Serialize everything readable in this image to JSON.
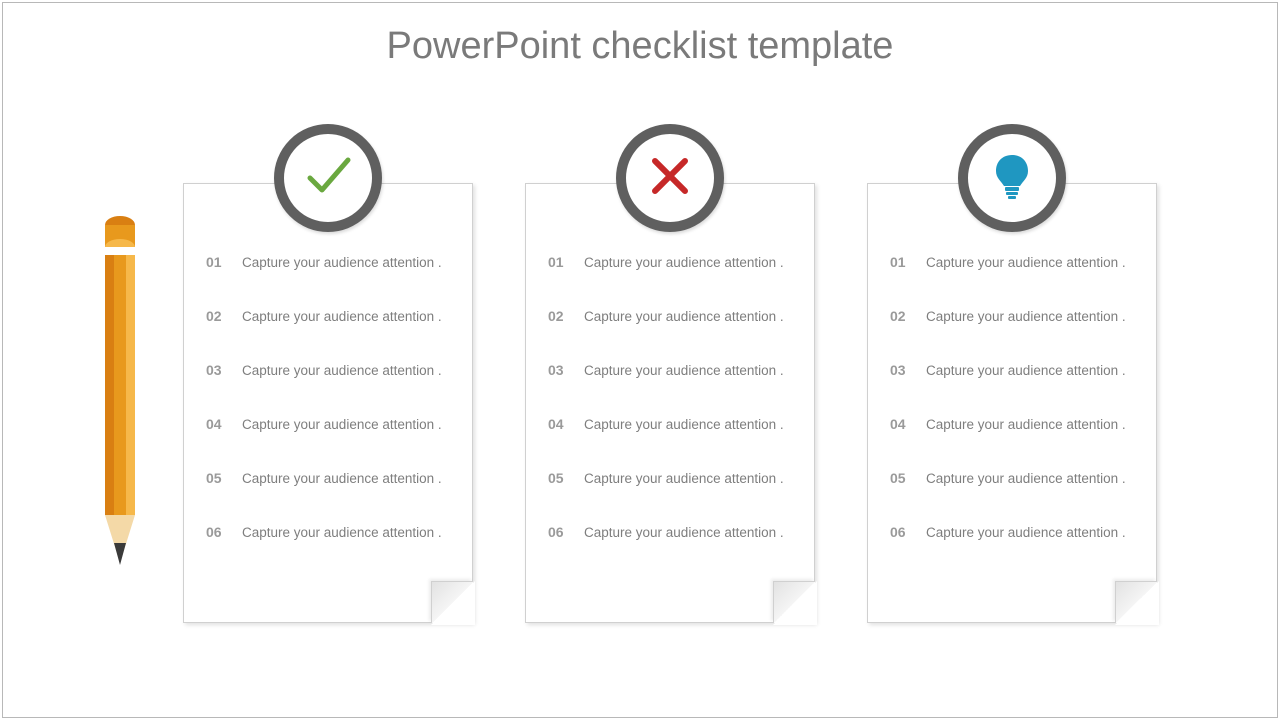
{
  "title": "PowerPoint checklist template",
  "cards": [
    {
      "icon": "check",
      "items": [
        {
          "num": "01",
          "text": "Capture your audience attention ."
        },
        {
          "num": "02",
          "text": "Capture your audience attention ."
        },
        {
          "num": "03",
          "text": "Capture your audience attention ."
        },
        {
          "num": "04",
          "text": "Capture your audience attention ."
        },
        {
          "num": "05",
          "text": "Capture your audience attention ."
        },
        {
          "num": "06",
          "text": "Capture your audience attention ."
        }
      ]
    },
    {
      "icon": "cross",
      "items": [
        {
          "num": "01",
          "text": "Capture your audience attention ."
        },
        {
          "num": "02",
          "text": "Capture your audience attention ."
        },
        {
          "num": "03",
          "text": "Capture your audience attention ."
        },
        {
          "num": "04",
          "text": "Capture your audience attention ."
        },
        {
          "num": "05",
          "text": "Capture your audience attention ."
        },
        {
          "num": "06",
          "text": "Capture your audience attention ."
        }
      ]
    },
    {
      "icon": "bulb",
      "items": [
        {
          "num": "01",
          "text": "Capture your audience attention ."
        },
        {
          "num": "02",
          "text": "Capture your audience attention ."
        },
        {
          "num": "03",
          "text": "Capture your audience attention ."
        },
        {
          "num": "04",
          "text": "Capture your audience attention ."
        },
        {
          "num": "05",
          "text": "Capture your audience attention ."
        },
        {
          "num": "06",
          "text": "Capture your audience attention ."
        }
      ]
    }
  ],
  "colors": {
    "check": "#6aa83f",
    "cross": "#c62828",
    "bulb": "#1f97c1",
    "badge_ring": "#5f5f5f",
    "pencil_body": "#e8991d",
    "pencil_wood": "#f4d9a7",
    "pencil_tip": "#3a3a3a"
  }
}
